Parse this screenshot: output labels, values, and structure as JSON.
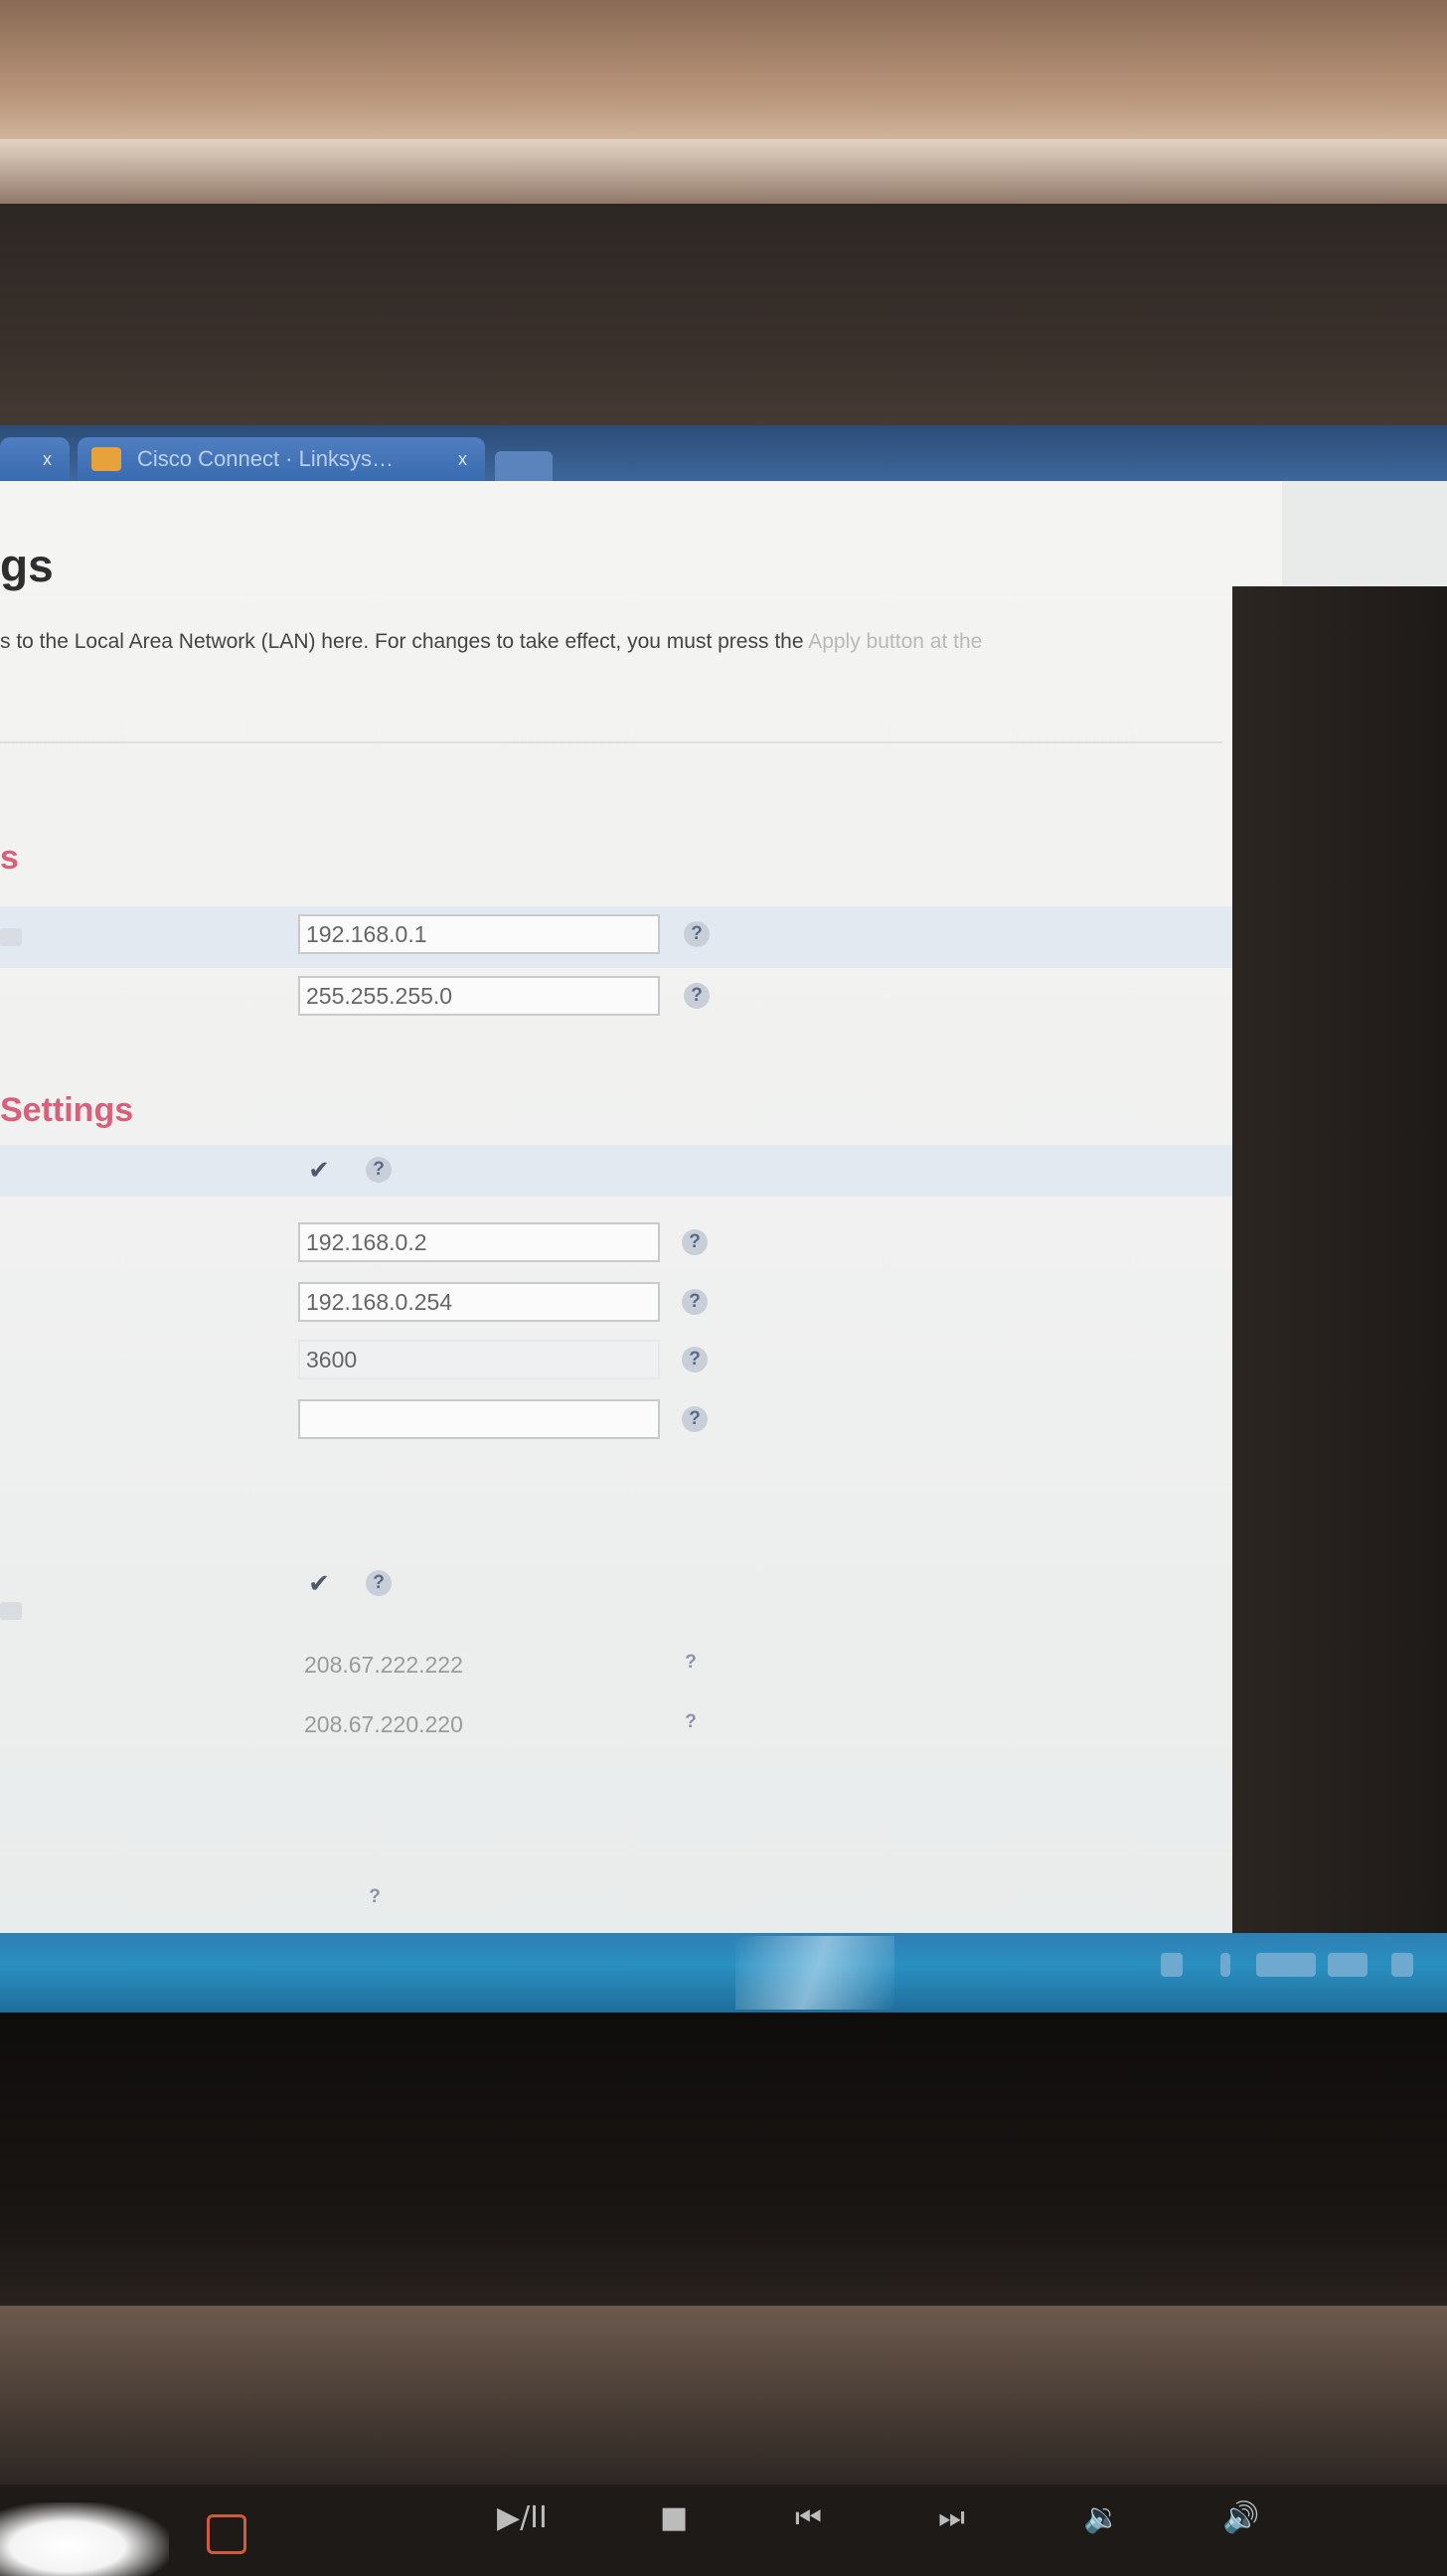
{
  "browser": {
    "tabs": [
      {
        "label": "",
        "close": "x"
      },
      {
        "label": "Cisco Connect · Linksys…",
        "close": "x"
      }
    ]
  },
  "page": {
    "title": "gs",
    "intro_visible": "s to the Local Area Network (LAN) here. For changes to take effect, you must press the ",
    "intro_faded": "Apply button at the",
    "router_section": {
      "heading": "s",
      "ip_address": "192.168.0.1",
      "subnet_mask": "255.255.255.0"
    },
    "dhcp_section": {
      "heading": "Settings",
      "enabled": true,
      "start_ip": "192.168.0.2",
      "end_ip": "192.168.0.254",
      "lease_time": "3600",
      "domain_name": ""
    },
    "dns_section": {
      "enabled": true,
      "primary_dns": "208.67.222.222",
      "secondary_dns": "208.67.220.220"
    },
    "help_glyph": "?",
    "check_glyph": "✔"
  },
  "media_keys": {
    "play_pause": "▶/II",
    "stop": "■",
    "prev": "⏮",
    "next": "⏭",
    "vol_down": "🔉",
    "vol_up": "🔊"
  }
}
